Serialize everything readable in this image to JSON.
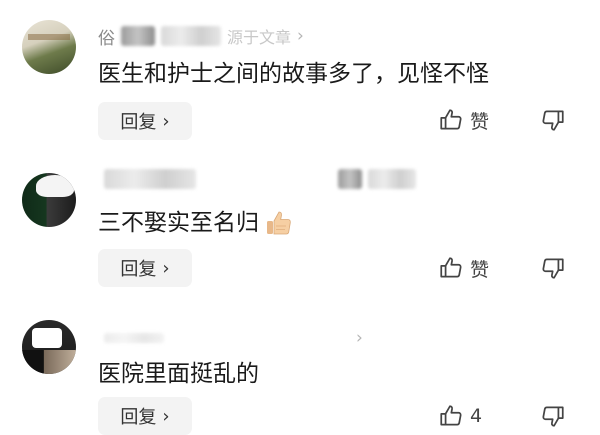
{
  "comments": [
    {
      "name": "俗",
      "faint_text": "源于文章",
      "content": "医生和护士之间的故事多了，见怪不怪",
      "reply_label": "回复",
      "like_label": "赞"
    },
    {
      "name": "",
      "faint_text": "",
      "content": "三不娶实至名归",
      "emoji": "thumbs-up",
      "reply_label": "回复",
      "like_label": "赞"
    },
    {
      "name": "",
      "faint_text": "",
      "content": "医院里面挺乱的",
      "reply_label": "回复",
      "like_label": "4"
    }
  ],
  "icons": {
    "reply_chevron": "chevron-right-icon",
    "like": "thumbs-up-icon",
    "dislike": "thumbs-down-icon"
  },
  "colors": {
    "text_main": "#1a1a1a",
    "text_secondary": "#8a8a8a",
    "reply_bg": "#f3f3f3",
    "icon": "#444444"
  }
}
